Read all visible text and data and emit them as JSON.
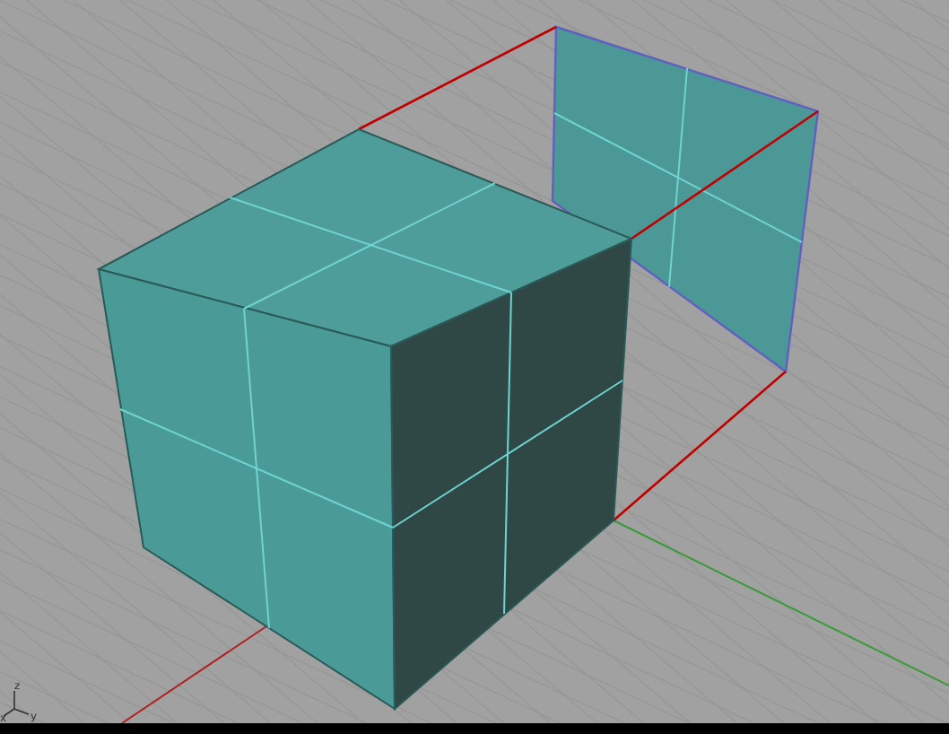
{
  "viewport": {
    "axis_labels": [
      "z",
      "x",
      "y"
    ]
  }
}
